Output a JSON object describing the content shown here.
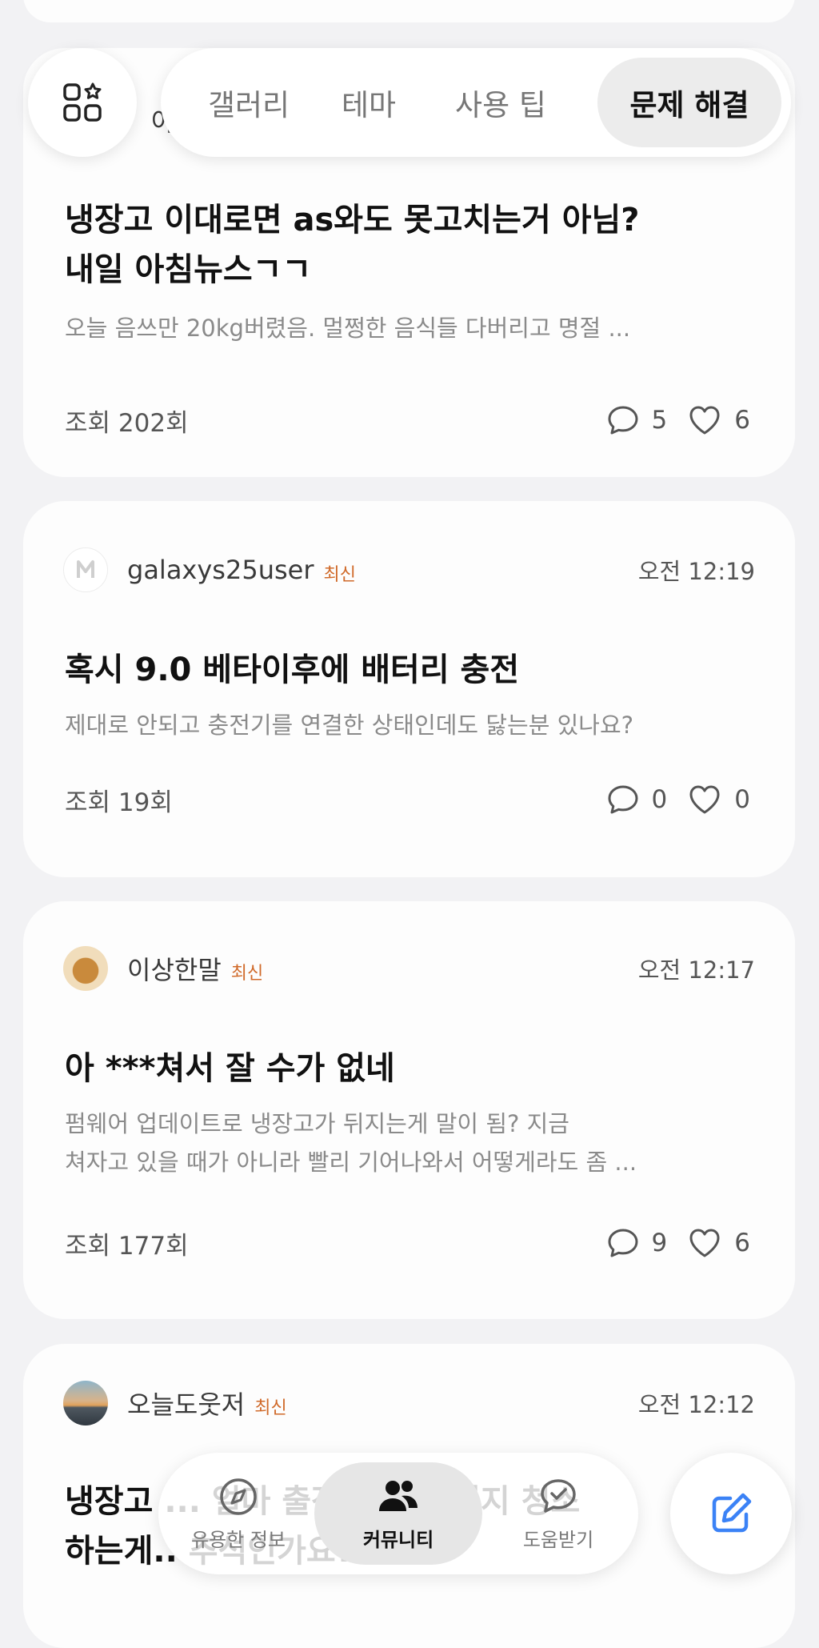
{
  "tabs": [
    "갤러리",
    "테마",
    "사용 팁",
    "문제 해결"
  ],
  "active_tab": "문제 해결",
  "posts": [
    {
      "author_partial": "아이",
      "title_lines": [
        "냉장고 이대로면 as와도 못고치는거 아님?",
        "내일 아침뉴스ㄱㄱ"
      ],
      "preview_lines": [
        "오늘 음쓰만 20kg버렸음. 멀쩡한 음식들 다버리고 명절 ..."
      ],
      "views": "조회 202회",
      "comments": "5",
      "likes": "6"
    },
    {
      "author": "galaxys25user",
      "badge": "최신",
      "time": "오전 12:19",
      "title_lines": [
        "혹시 9.0 베타이후에 배터리 충전"
      ],
      "preview_lines": [
        "제대로 안되고 충전기를 연결한 상태인데도 닳는분 있나요?"
      ],
      "views": "조회 19회",
      "comments": "0",
      "likes": "0"
    },
    {
      "author": "이상한말",
      "badge": "최신",
      "time": "오전 12:17",
      "title_lines": [
        "아 ***쳐서 잘 수가 없네"
      ],
      "preview_lines": [
        "펌웨어 업데이트로 냉장고가 뒤지는게 말이 됨?  지금",
        "쳐자고 있을 때가 아니라 빨리 기어나와서 어떻게라도 좀 ..."
      ],
      "views": "조회 177회",
      "comments": "9",
      "likes": "6"
    },
    {
      "author": "오늘도웃저",
      "badge": "최신",
      "time": "오전 12:12",
      "title_lines": [
        "냉장고 ... 얼마 출장에 물건 버지 청소",
        "하는게.. 추석인가요??"
      ]
    }
  ],
  "bottom_nav": [
    "유용한 정보",
    "커뮤니티",
    "도움받기"
  ],
  "active_nav": "커뮤니티",
  "colors": {
    "badge": "#d06a2a",
    "accent": "#3b82f6",
    "background": "#f2f2f4"
  }
}
